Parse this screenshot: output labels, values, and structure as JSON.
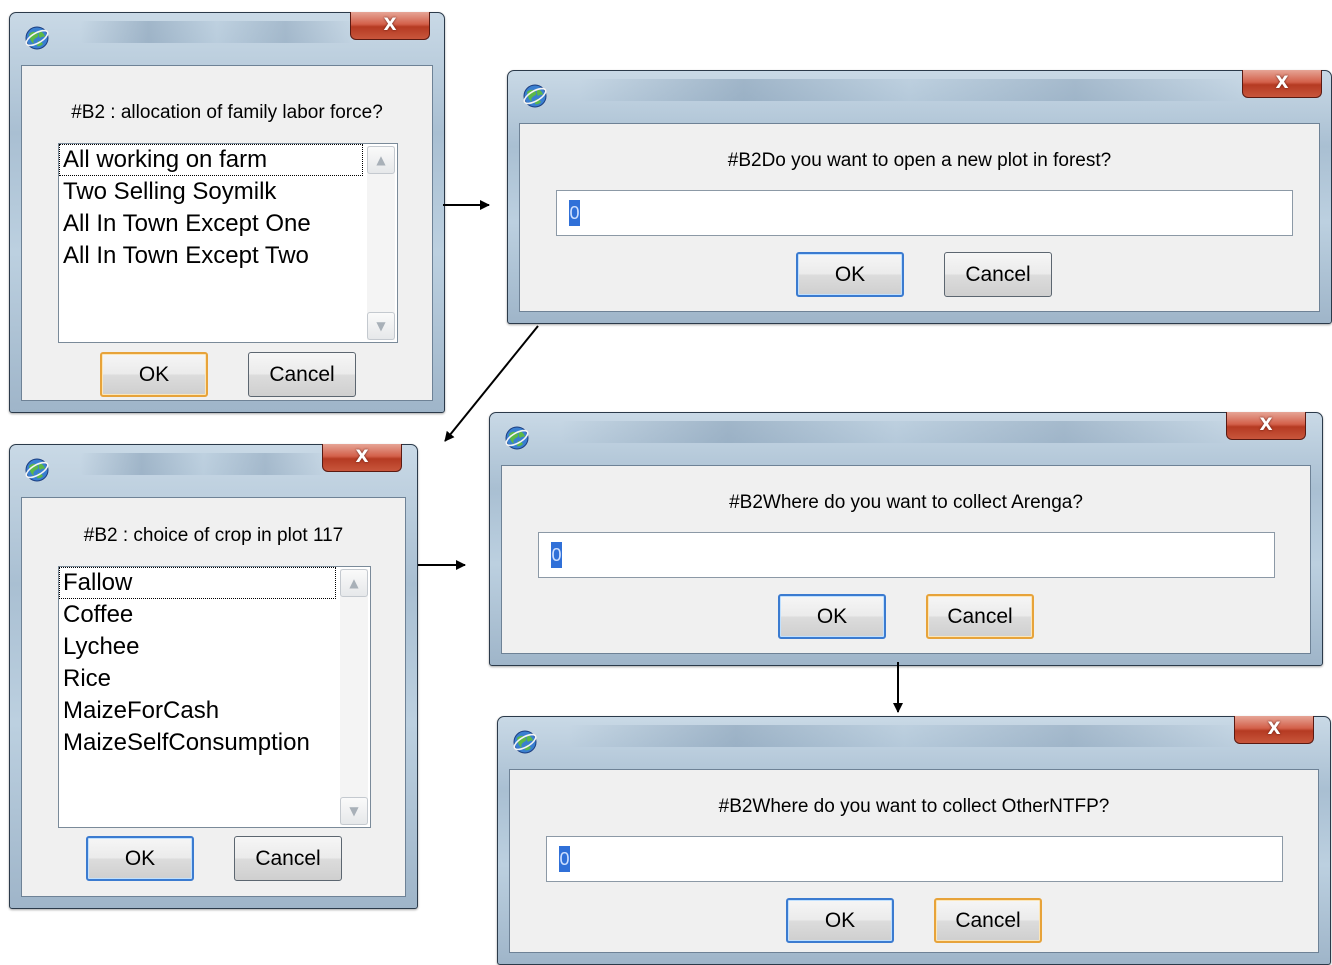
{
  "dialogs": {
    "labor": {
      "prompt": "#B2 : allocation of family labor force?",
      "items": [
        "All working on farm",
        "Two Selling Soymilk",
        "All In Town Except One",
        "All In Town Except Two"
      ],
      "ok": "OK",
      "cancel": "Cancel",
      "close": "X"
    },
    "forest": {
      "prompt": "#B2Do you want to open a new plot in forest?",
      "value": "0",
      "ok": "OK",
      "cancel": "Cancel",
      "close": "X"
    },
    "crop": {
      "prompt": "#B2 : choice of crop in plot 117",
      "items": [
        "Fallow",
        "Coffee",
        "Lychee",
        "Rice",
        "MaizeForCash",
        "MaizeSelfConsumption"
      ],
      "ok": "OK",
      "cancel": "Cancel",
      "close": "X"
    },
    "arenga": {
      "prompt": "#B2Where do you want to collect Arenga?",
      "value": "0",
      "ok": "OK",
      "cancel": "Cancel",
      "close": "X"
    },
    "ntfp": {
      "prompt": "#B2Where do you want to collect OtherNTFP?",
      "value": "0",
      "ok": "OK",
      "cancel": "Cancel",
      "close": "X"
    }
  },
  "icons": {
    "app": "globe-app-icon",
    "close": "close-icon",
    "scroll_up": "chevron-up-icon",
    "scroll_down": "chevron-down-icon",
    "flow_arrow": "arrow-icon"
  },
  "colors": {
    "close_button": "#c8563c",
    "default_button_orange": "#e7a33a",
    "default_button_blue": "#3b7bd0",
    "selection": "#3070d8"
  }
}
